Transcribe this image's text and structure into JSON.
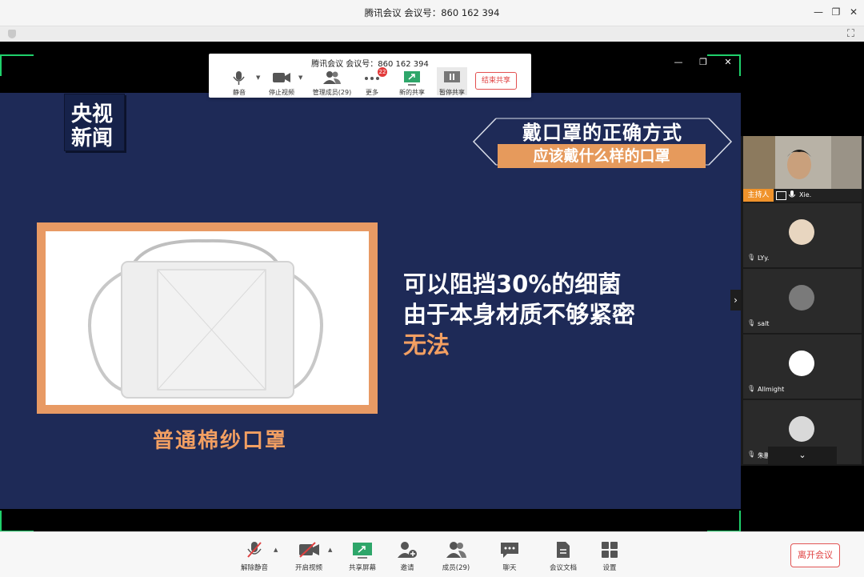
{
  "window": {
    "title": "腾讯会议 会议号：860 162 394"
  },
  "share_toolbar": {
    "title": "腾讯会议 会议号：860 162 394",
    "items": [
      {
        "label": "静音",
        "icon": "mic-icon"
      },
      {
        "label": "停止视频",
        "icon": "video-camera-icon"
      },
      {
        "label": "管理成员(29)",
        "icon": "members-icon"
      },
      {
        "label": "更多",
        "icon": "more-dots-icon",
        "badge": "22"
      },
      {
        "label": "新的共享",
        "icon": "new-share-icon"
      },
      {
        "label": "暂停共享",
        "icon": "pause-share-icon"
      }
    ],
    "end_share_label": "结束共享"
  },
  "slide": {
    "logo_line1": "央视",
    "logo_line2": "新闻",
    "title_main": "戴口罩的正确方式",
    "title_sub": "应该戴什么样的口罩",
    "caption": "普通棉纱口罩",
    "line1": "可以阻挡30%的细菌",
    "line2": "由于本身材质不够紧密",
    "line3": "无法",
    "colors": {
      "background": "#1e2a57",
      "accent": "#e69a5c"
    }
  },
  "participants": [
    {
      "name": "Xie.",
      "role": "主持人"
    },
    {
      "name": "LYy."
    },
    {
      "name": "salt"
    },
    {
      "name": "Allmight"
    },
    {
      "name": "朱鹏辉"
    }
  ],
  "bottom_bar": {
    "items": [
      {
        "label": "解除静音",
        "icon": "mic-muted-icon"
      },
      {
        "label": "开启视频",
        "icon": "video-off-icon"
      },
      {
        "label": "共享屏幕",
        "icon": "share-screen-icon"
      },
      {
        "label": "邀请",
        "icon": "invite-icon"
      },
      {
        "label": "成员(29)",
        "icon": "members-icon"
      },
      {
        "label": "聊天",
        "icon": "chat-icon"
      },
      {
        "label": "会议文档",
        "icon": "document-icon"
      },
      {
        "label": "设置",
        "icon": "settings-grid-icon"
      }
    ],
    "leave_label": "离开会议"
  }
}
